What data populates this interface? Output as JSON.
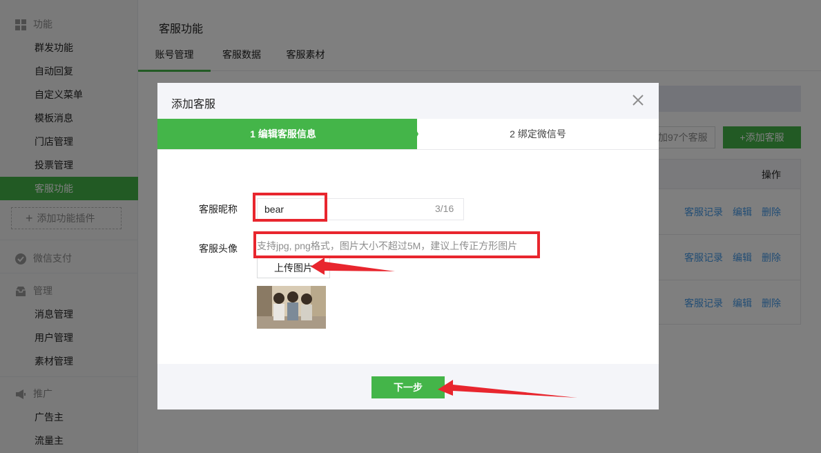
{
  "sidebar": {
    "sections": [
      {
        "title": "功能",
        "icon": "grid-icon",
        "items": [
          "群发功能",
          "自动回复",
          "自定义菜单",
          "模板消息",
          "门店管理",
          "投票管理",
          "客服功能"
        ]
      },
      {
        "title": "微信支付",
        "icon": "wechat-pay-icon",
        "items": []
      },
      {
        "title": "管理",
        "icon": "inbox-icon",
        "items": [
          "消息管理",
          "用户管理",
          "素材管理"
        ]
      },
      {
        "title": "推广",
        "icon": "megaphone-icon",
        "items": [
          "广告主",
          "流量主"
        ]
      }
    ],
    "active_item": "客服功能",
    "add_plugin_label": "添加功能插件"
  },
  "main": {
    "title": "客服功能",
    "tabs": [
      "账号管理",
      "客服数据",
      "客服素材"
    ],
    "active_tab": "账号管理",
    "count_text": "加97个客服",
    "add_button": "+添加客服",
    "table": {
      "op_header": "操作",
      "rows": [
        [
          "客服记录",
          "编辑",
          "删除"
        ],
        [
          "客服记录",
          "编辑",
          "删除"
        ],
        [
          "客服记录",
          "编辑",
          "删除"
        ]
      ]
    }
  },
  "dialog": {
    "title": "添加客服",
    "steps": [
      "1 编辑客服信息",
      "2 绑定微信号"
    ],
    "active_step": 1,
    "nickname_label": "客服昵称",
    "nickname_value": "bear",
    "nickname_count": "3/16",
    "avatar_label": "客服头像",
    "avatar_tip": "支持jpg, png格式，图片大小不超过5M，建议上传正方形图片",
    "upload_button": "上传图片",
    "next_button": "下一步"
  },
  "colors": {
    "accent": "#44b549",
    "link": "#459ae9",
    "annotation": "#e8262e"
  }
}
